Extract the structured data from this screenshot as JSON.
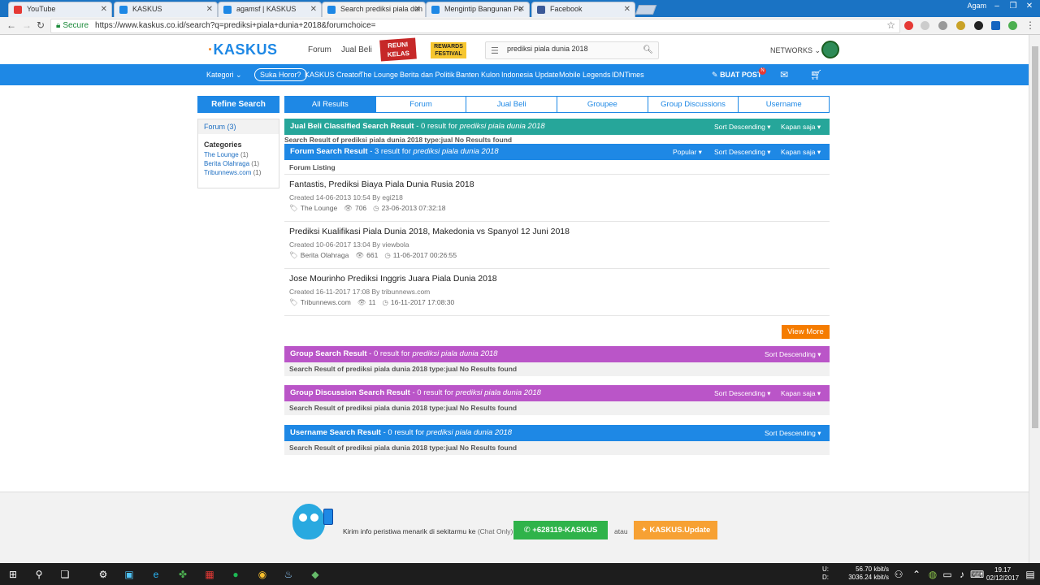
{
  "browser": {
    "tabs": [
      {
        "label": "YouTube",
        "fav_color": "#e53935"
      },
      {
        "label": "KASKUS",
        "fav_color": "#1e88e5"
      },
      {
        "label": "agamsf | KASKUS",
        "fav_color": "#1e88e5"
      },
      {
        "label": "Search prediksi piala dun",
        "fav_color": "#1e88e5"
      },
      {
        "label": "Mengintip Bangunan Pe",
        "fav_color": "#1e88e5"
      },
      {
        "label": "Facebook",
        "fav_color": "#3b5998"
      }
    ],
    "active_tab_index": 3,
    "user": "Agam",
    "secure_label": "Secure",
    "url": "https://www.kaskus.co.id/search?q=prediksi+piala+dunia+2018&forumchoice="
  },
  "header": {
    "logo": "KASKUS",
    "nav": [
      "Forum",
      "Jual Beli"
    ],
    "badge_red": "REUNI KELAS",
    "badge_yellow": "REWARDS FESTIVAL",
    "search_value": "prediksi piala dunia 2018",
    "networks": "NETWORKS"
  },
  "bluebar": {
    "kategori": "Kategori",
    "suka_horor": "Suka Horor?",
    "links": [
      "KASKUS Creator",
      "The Lounge",
      "Berita dan Politik",
      "Banten Kulon",
      "Indonesia Update",
      "Mobile Legends",
      "IDNTimes"
    ],
    "buat_post": "BUAT POST",
    "notif_count": "N"
  },
  "sidebar": {
    "refine": "Refine Search",
    "forum_link": "Forum (3)",
    "categories_title": "Categories",
    "categories": [
      {
        "name": "The Lounge",
        "count": "(1)"
      },
      {
        "name": "Berita Olahraga",
        "count": "(1)"
      },
      {
        "name": "Tribunnews.com",
        "count": "(1)"
      }
    ]
  },
  "result_tabs": [
    "All Results",
    "Forum",
    "Jual Beli",
    "Groupee",
    "Group Discussions",
    "Username"
  ],
  "query": "prediksi piala dunia 2018",
  "sections": {
    "jualbeli": {
      "title": "Jual Beli Classified Search Result",
      "count_text": " - 0 result for ",
      "color": "#26a69a",
      "no_result": "Search Result of prediksi piala dunia 2018 type:jual No Results found"
    },
    "forum": {
      "title": "Forum Search Result",
      "count_text": " - 3 result for ",
      "color": "#1e88e5",
      "listing": "Forum Listing"
    },
    "group": {
      "title": "Group Search Result",
      "count_text": " - 0 result for ",
      "color": "#ba55c8",
      "no_result": "Search Result of prediksi piala dunia 2018 type:jual No Results found"
    },
    "groupdisc": {
      "title": "Group Discussion Search Result",
      "count_text": " - 0 result for ",
      "color": "#ba55c8",
      "no_result": "Search Result of prediksi piala dunia 2018 type:jual No Results found"
    },
    "username": {
      "title": "Username Search Result",
      "count_text": " - 0 result for ",
      "color": "#1e88e5",
      "no_result": "Search Result of prediksi piala dunia 2018 type:jual No Results found"
    }
  },
  "controls": {
    "popular": "Popular",
    "sort": "Sort Descending",
    "kapan": "Kapan saja"
  },
  "threads": [
    {
      "title": "Fantastis, Prediksi Biaya Piala Dunia Rusia 2018",
      "created": "Created 14-06-2013 10:54 By egi218",
      "category": "The Lounge",
      "views": "706",
      "last": "23-06-2013 07:32:18"
    },
    {
      "title": "Prediksi Kualifikasi Piala Dunia 2018, Makedonia vs Spanyol 12 Juni 2018",
      "created": "Created 10-06-2017 13:04 By viewbola",
      "category": "Berita Olahraga",
      "views": "661",
      "last": "11-06-2017 00:26:55"
    },
    {
      "title": "Jose Mourinho Prediksi Inggris Juara Piala Dunia 2018",
      "created": "Created 16-11-2017 17:08 By tribunnews.com",
      "category": "Tribunnews.com",
      "views": "11",
      "last": "16-11-2017 17:08:30"
    }
  ],
  "view_more": "View More",
  "footer": {
    "info": "Kirim info peristiwa menarik di sekitarmu ke",
    "chat_only": "(Chat Only)",
    "whatsapp": "+628119-KASKUS",
    "atau": "atau",
    "update": "KASKUS.Update"
  },
  "taskbar": {
    "up_label": "U:",
    "up_value": "56.70 kbit/s",
    "down_label": "D:",
    "down_value": "3036.24 kbit/s",
    "time": "19.17",
    "date": "02/12/2017"
  }
}
